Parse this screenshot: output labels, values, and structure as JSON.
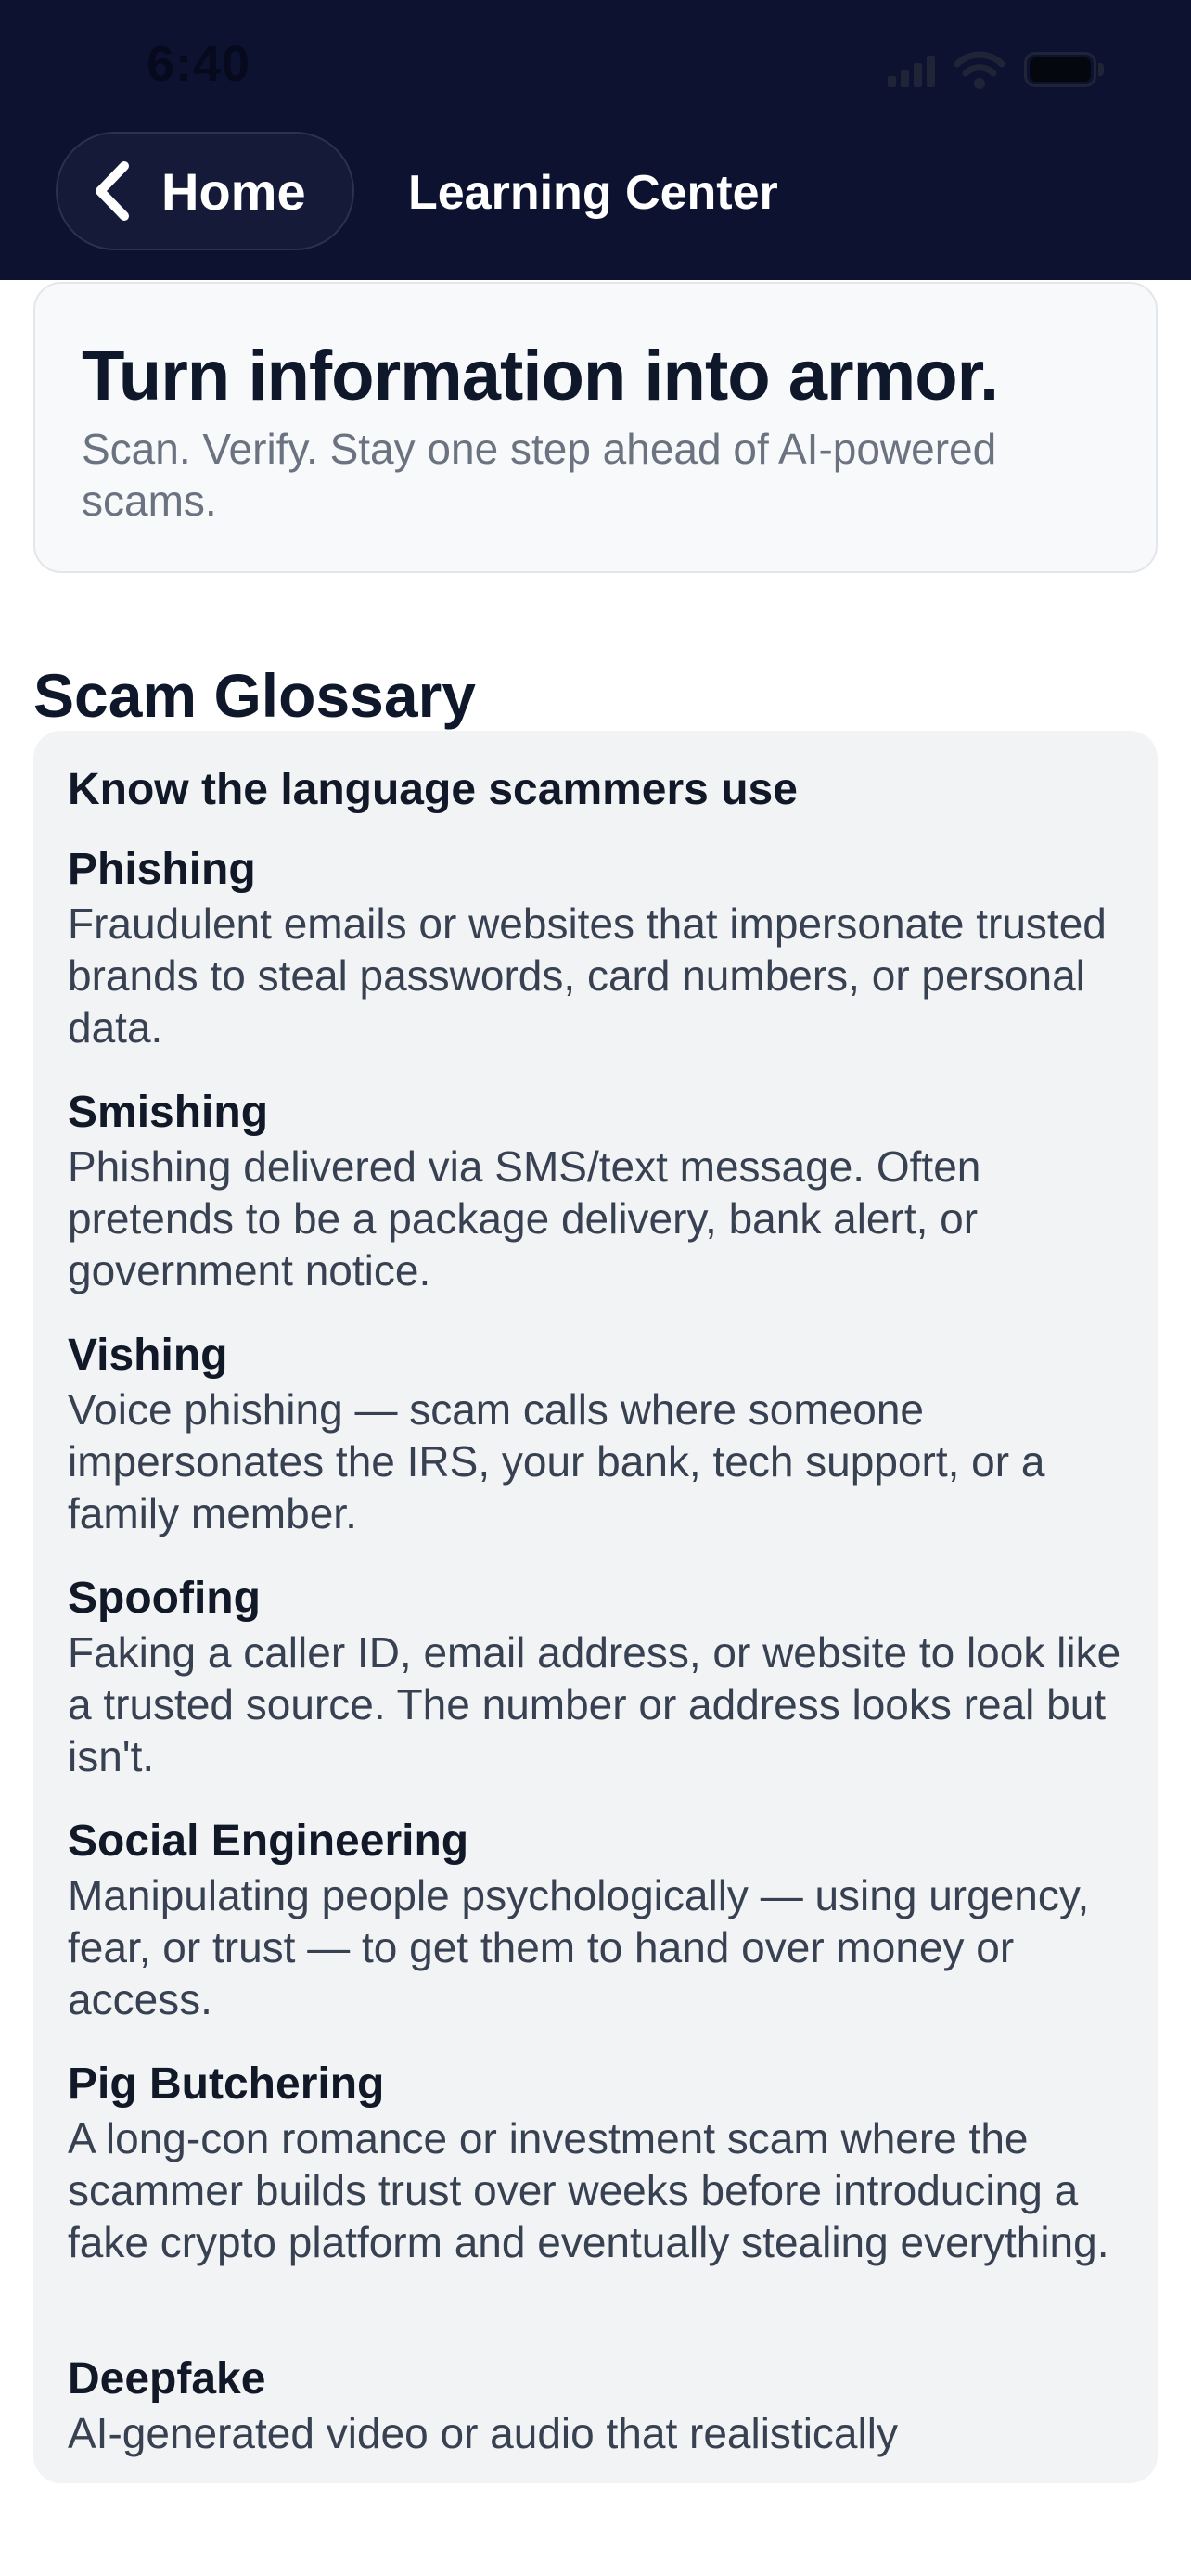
{
  "status_bar": {
    "time": "6:40"
  },
  "nav": {
    "back_label": "Home",
    "title": "Learning Center"
  },
  "hero": {
    "title": "Turn information into armor.",
    "subtitle": "Scan. Verify. Stay one step ahead of AI-powered scams."
  },
  "glossary": {
    "section_title": "Scam Glossary",
    "heading": "Know the language scammers use",
    "terms": [
      {
        "name": "Phishing",
        "definition": "Fraudulent emails or websites that impersonate trusted brands to steal passwords, card numbers, or personal data."
      },
      {
        "name": "Smishing",
        "definition": "Phishing delivered via SMS/text message. Often pretends to be a package delivery, bank alert, or government notice."
      },
      {
        "name": "Vishing",
        "definition": "Voice phishing — scam calls where someone impersonates the IRS, your bank, tech support, or a family member."
      },
      {
        "name": "Spoofing",
        "definition": "Faking a caller ID, email address, or website to look like a trusted source. The number or address looks real but isn't."
      },
      {
        "name": "Social Engineering",
        "definition": "Manipulating people psychologically — using urgency, fear, or trust — to get them to hand over money or access."
      },
      {
        "name": "Pig Butchering",
        "definition": "A long-con romance or investment scam where the scammer builds trust over weeks before introducing a fake crypto platform and eventually stealing everything."
      },
      {
        "name": "Deepfake",
        "definition": "AI-generated video or audio that realistically"
      }
    ]
  }
}
